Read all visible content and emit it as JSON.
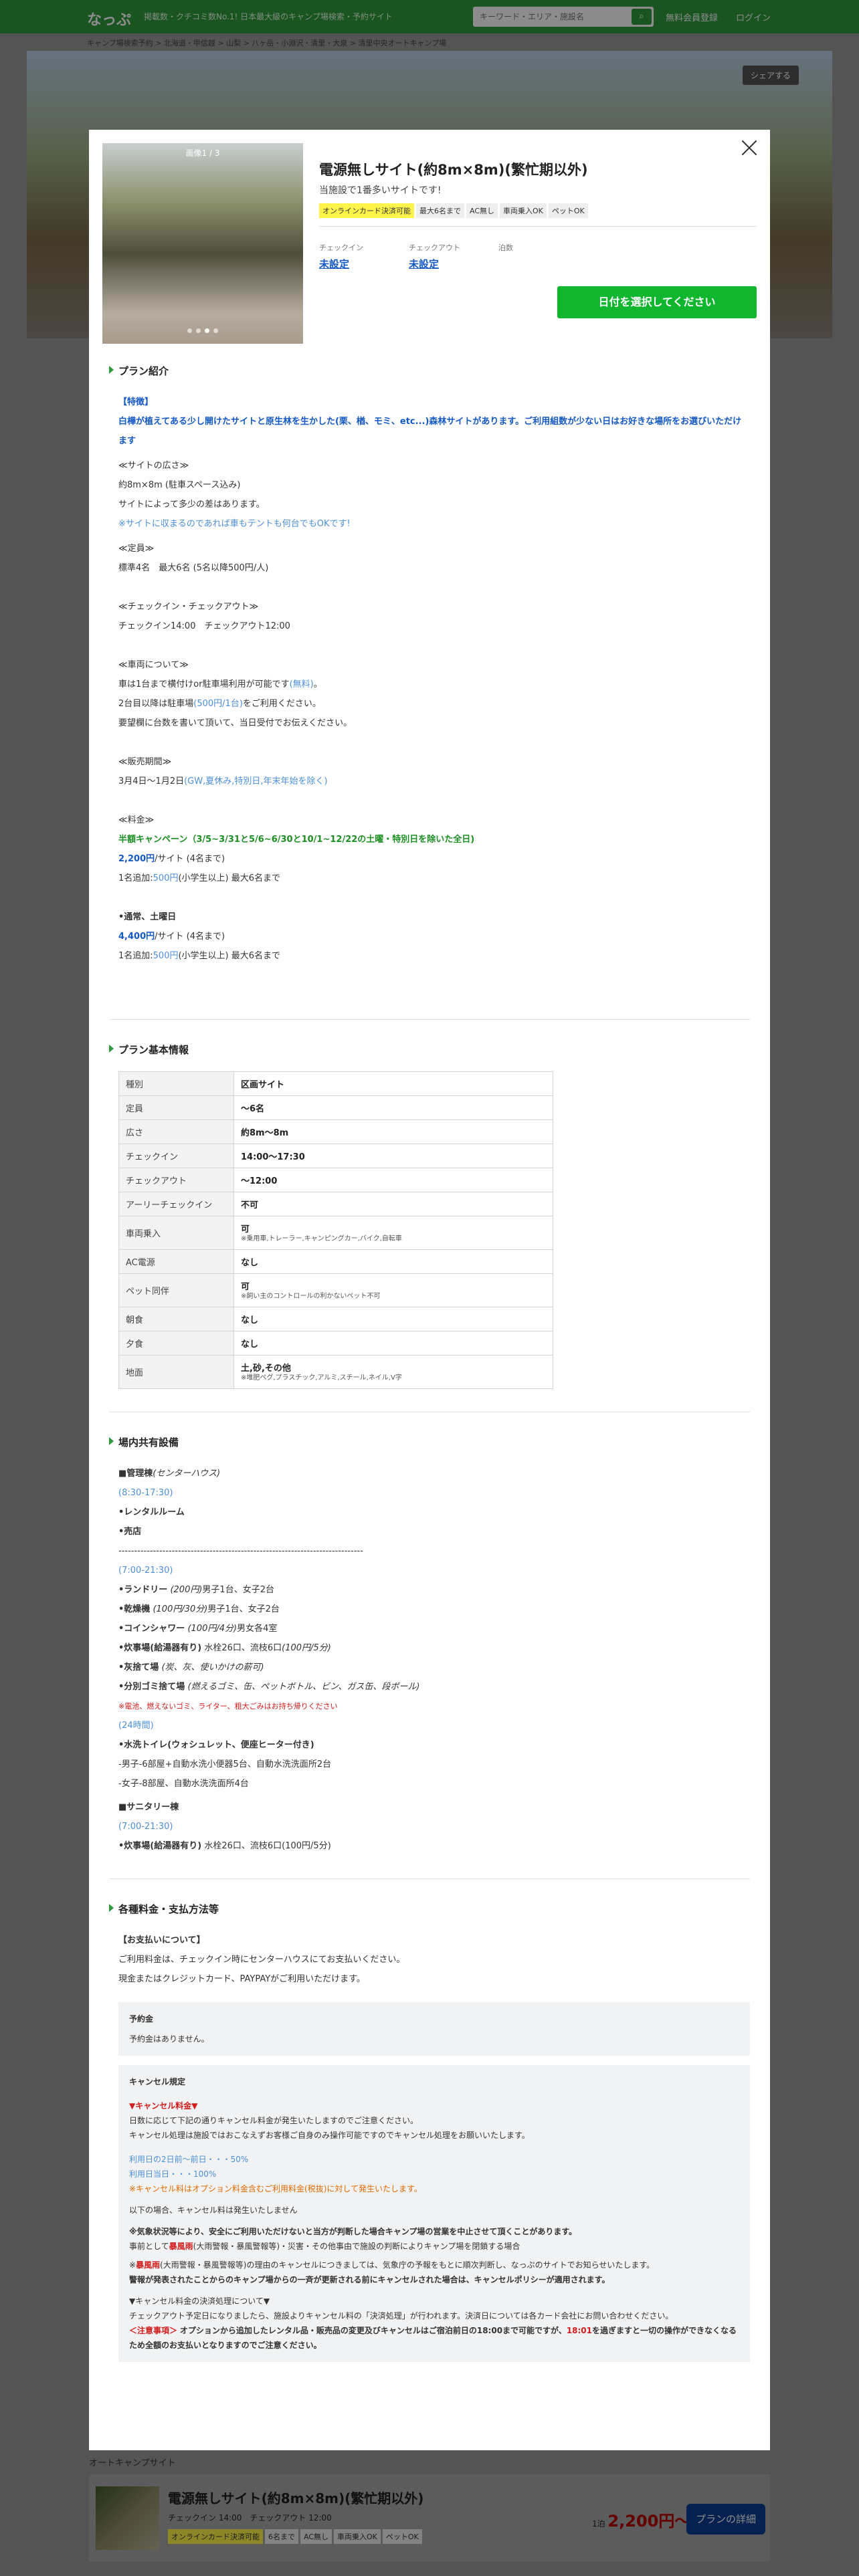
{
  "header": {
    "logo": "なっぷ",
    "tagline": "掲載数・クチコミ数No.1! 日本最大級のキャンプ場検索・予約サイト",
    "search_placeholder": "キーワード・エリア・施設名",
    "links": [
      "無料会員登録",
      "ログイン"
    ]
  },
  "breadcrumb": "キャンプ場検索予約 > 北海道・甲信越 > 山梨 > 八ヶ岳・小淵沢・清里・大泉 > 清里中央オートキャンプ場",
  "share_label": "シェアする",
  "modal": {
    "photo_counter": "画像1 / 3",
    "title": "電源無しサイト(約8m×8m)(繁忙期以外)",
    "subtitle": "当施設で1番多いサイトです!",
    "tags": [
      "オンラインカード決済可能",
      "最大6名まで",
      "AC無し",
      "車両乗入OK",
      "ペットOK"
    ],
    "checkin_label": "チェックイン",
    "checkin_value": "未設定",
    "checkout_label": "チェックアウト",
    "checkout_value": "未設定",
    "nights_label": "泊数",
    "date_button": "日付を選択してください"
  },
  "intro": {
    "heading": "プラン紹介",
    "feature_head": "【特徴】",
    "feature_text": "白樺が植えてある少し開けたサイトと原生林を生かした(栗、楢、モミ、etc...)森林サイトがあります。ご利用組数が少ない日はお好きな場所をお選びいただけます",
    "area_head": "≪サイトの広さ≫",
    "area_1": "約8m×8m (駐車スペース込み)",
    "area_2": "サイトによって多少の差はあります。",
    "area_3": "※サイトに収まるのであれば車もテントも何台でもOKです!",
    "cap_head": "≪定員≫",
    "cap_1": "標準4名　最大6名 (5名以降500円/人)",
    "cico_head": "≪チェックイン・チェックアウト≫",
    "cico_1": "チェックイン14:00　チェックアウト12:00",
    "car_head": "≪車両について≫",
    "car_1a": "車は1台まで横付けor駐車場利用が可能です",
    "car_1b": "(無料)",
    "car_1c": "。",
    "car_2a": "2台目以降は駐車場",
    "car_2b": "(500円/1台)",
    "car_2c": "をご利用ください。",
    "car_3": "要望欄に台数を書いて頂いて、当日受付でお伝えください。",
    "period_head": "≪販売期間≫",
    "period_1a": "3月4日〜1月2日",
    "period_1b": "(GW,夏休み,特別日,年末年始を除く)",
    "fee_head": "≪料金≫",
    "campaign": "半額キャンペーン（3/5~3/31と5/6~6/30と10/1~12/22の土曜・特別日を除いた全日)",
    "fee1_price": "2,200円",
    "fee1_unit": "/サイト (4名まで)",
    "fee1_add_a": "1名追加:",
    "fee1_add_b": "500円",
    "fee1_add_c": "(小学生以上) 最大6名まで",
    "normal_head": "•通常、土曜日",
    "fee2_price": "4,400円",
    "fee2_unit": "/サイト (4名まで)",
    "fee2_add_a": "1名追加:",
    "fee2_add_b": "500円",
    "fee2_add_c": "(小学生以上) 最大6名まで"
  },
  "basic": {
    "heading": "プラン基本情報",
    "rows": [
      {
        "k": "種別",
        "v": "区画サイト",
        "note": ""
      },
      {
        "k": "定員",
        "v": "〜6名",
        "note": ""
      },
      {
        "k": "広さ",
        "v": "約8m〜8m",
        "note": ""
      },
      {
        "k": "チェックイン",
        "v": "14:00〜17:30",
        "note": ""
      },
      {
        "k": "チェックアウト",
        "v": "〜12:00",
        "note": ""
      },
      {
        "k": "アーリーチェックイン",
        "v": "不可",
        "note": ""
      },
      {
        "k": "車両乗入",
        "v": "可",
        "note": "※乗用車,トレーラー,キャンピングカー,バイク,自転車"
      },
      {
        "k": "AC電源",
        "v": "なし",
        "note": ""
      },
      {
        "k": "ペット同伴",
        "v": "可",
        "note": "※飼い主のコントロールの利かないペット不可"
      },
      {
        "k": "朝食",
        "v": "なし",
        "note": ""
      },
      {
        "k": "夕食",
        "v": "なし",
        "note": ""
      },
      {
        "k": "地面",
        "v": "土,砂,その他",
        "note": "※堆肥ペグ,プラスチック,アルミ,スチール,ネイル,V字"
      }
    ]
  },
  "facilities": {
    "heading": "場内共有設備",
    "mgmt_a": "■管理棟",
    "mgmt_b": "(センターハウス)",
    "h1": "(8:30-17:30)",
    "f1": "•レンタルルーム",
    "f2": "•売店",
    "dash": "------------------------------------------------------------------------------",
    "h2": "(7:00-21:30)",
    "laundry_a": "•ランドリー",
    "laundry_b": "(200円)",
    "laundry_c": "男子1台、女子2台",
    "dryer_a": "•乾燥機",
    "dryer_b": "(100円/30分)",
    "dryer_c": "男子1台、女子2台",
    "shower_a": "•コインシャワー",
    "shower_b": "(100円/4分)",
    "shower_c": "男女各4室",
    "kitchen_a": "•炊事場(給湯器有り)",
    "kitchen_b": "水栓26口、流枝6口",
    "kitchen_c": "(100円/5分)",
    "ash_a": "•灰捨て場",
    "ash_b": "(炭、灰、使いかけの薪可)",
    "trash_a": "•分別ゴミ捨て場",
    "trash_b": "(燃えるゴミ、缶、ペットボトル、ビン、ガス缶、段ボール)",
    "trash_note": "※電池、燃えないゴミ、ライター、粗大ごみはお持ち帰りください",
    "h3": "(24時間)",
    "toilet": "•水洗トイレ(ウォシュレット、便座ヒーター付き)",
    "toilet_m": "-男子-6部屋+自動水洗小便器5台、自動水洗洗面所2台",
    "toilet_f": "-女子-8部屋、自動水洗洗面所4台",
    "sanitary": "■サニタリー棟",
    "h4": "(7:00-21:30)",
    "kitchen2_a": "•炊事場(給湯器有り)",
    "kitchen2_b": "水栓26口、流枝6口(100円/5分)"
  },
  "payment": {
    "heading": "各種料金・支払方法等",
    "pay_head": "【お支払いについて】",
    "pay_1": "ご利用料金は、チェックイン時にセンターハウスにてお支払いください。",
    "pay_2": "現金またはクレジットカード、PAYPAYがご利用いただけます。",
    "deposit_title": "予約金",
    "deposit_text": "予約金はありません。",
    "cancel_title": "キャンセル規定",
    "cancel_head": "▼キャンセル料金▼",
    "cancel_1": "日数に応じて下記の通りキャンセル料金が発生いたしますのでご注意ください。",
    "cancel_2": "キャンセル処理は施設ではおこなえずお客様ご自身のみ操作可能ですのでキャンセル処理をお願いいたします。",
    "rate_1": "利用日の2日前〜前日・・・50%",
    "rate_2": "利用日当日・・・100%",
    "option_note": "※キャンセル料はオプション料金含むご利用料金(税抜)に対して発生いたします。",
    "nofee": "以下の場合、キャンセル料は発生いたしません",
    "weather_1": "※気象状況等により、安全にご利用いただけないと当方が判断した場合キャンプ場の営業を中止させて頂くことがあります。",
    "weather_2": "事前として",
    "weather_2b": "暴風雨",
    "weather_2c": "(大雨警報・暴風警報等)・災害・その他事由で施設の判断によりキャンプ場を閉鎖する場合",
    "storm_a": "※",
    "storm_b": "暴風雨",
    "storm_c": "(大雨警報・暴風警報等)の理由のキャンセルにつきましては、気象庁の予報をもとに順次判断し、なっぷのサイトでお知らせいたします。",
    "storm_2": "警報が発表されたことからのキャンプ場からの一斉が更新される前にキャンセルされた場合は、キャンセルポリシーが適用されます。",
    "proc_head": "▼キャンセル料金の決済処理について▼",
    "proc_1": "チェックアウト予定日になりましたら、施設よりキャンセル料の「決済処理」が行われます。決済日については各カード会社にお問い合わせください。",
    "caution_a": "＜注意事項＞",
    "caution_b": "オプションから追加したレンタル品・販売品の変更及びキャンセルはご宿泊前日の18:00まで可能ですが、",
    "caution_c": "18:01",
    "caution_d": "を過ぎますと一切の操作ができなくなるため全額のお支払いとなりますのでご注意ください。"
  },
  "below": {
    "heading": "オートキャンプサイト",
    "card_title": "電源無しサイト(約8m×8m)(繁忙期以外)",
    "card_meta": "チェックイン 14:00　チェックアウト 12:00",
    "tags": [
      "オンラインカード決済可能",
      "6名まで",
      "AC無し",
      "車両乗入OK",
      "ペットOK"
    ],
    "price_prefix": "1泊",
    "price": "2,200円〜",
    "detail_button": "プランの詳細"
  }
}
